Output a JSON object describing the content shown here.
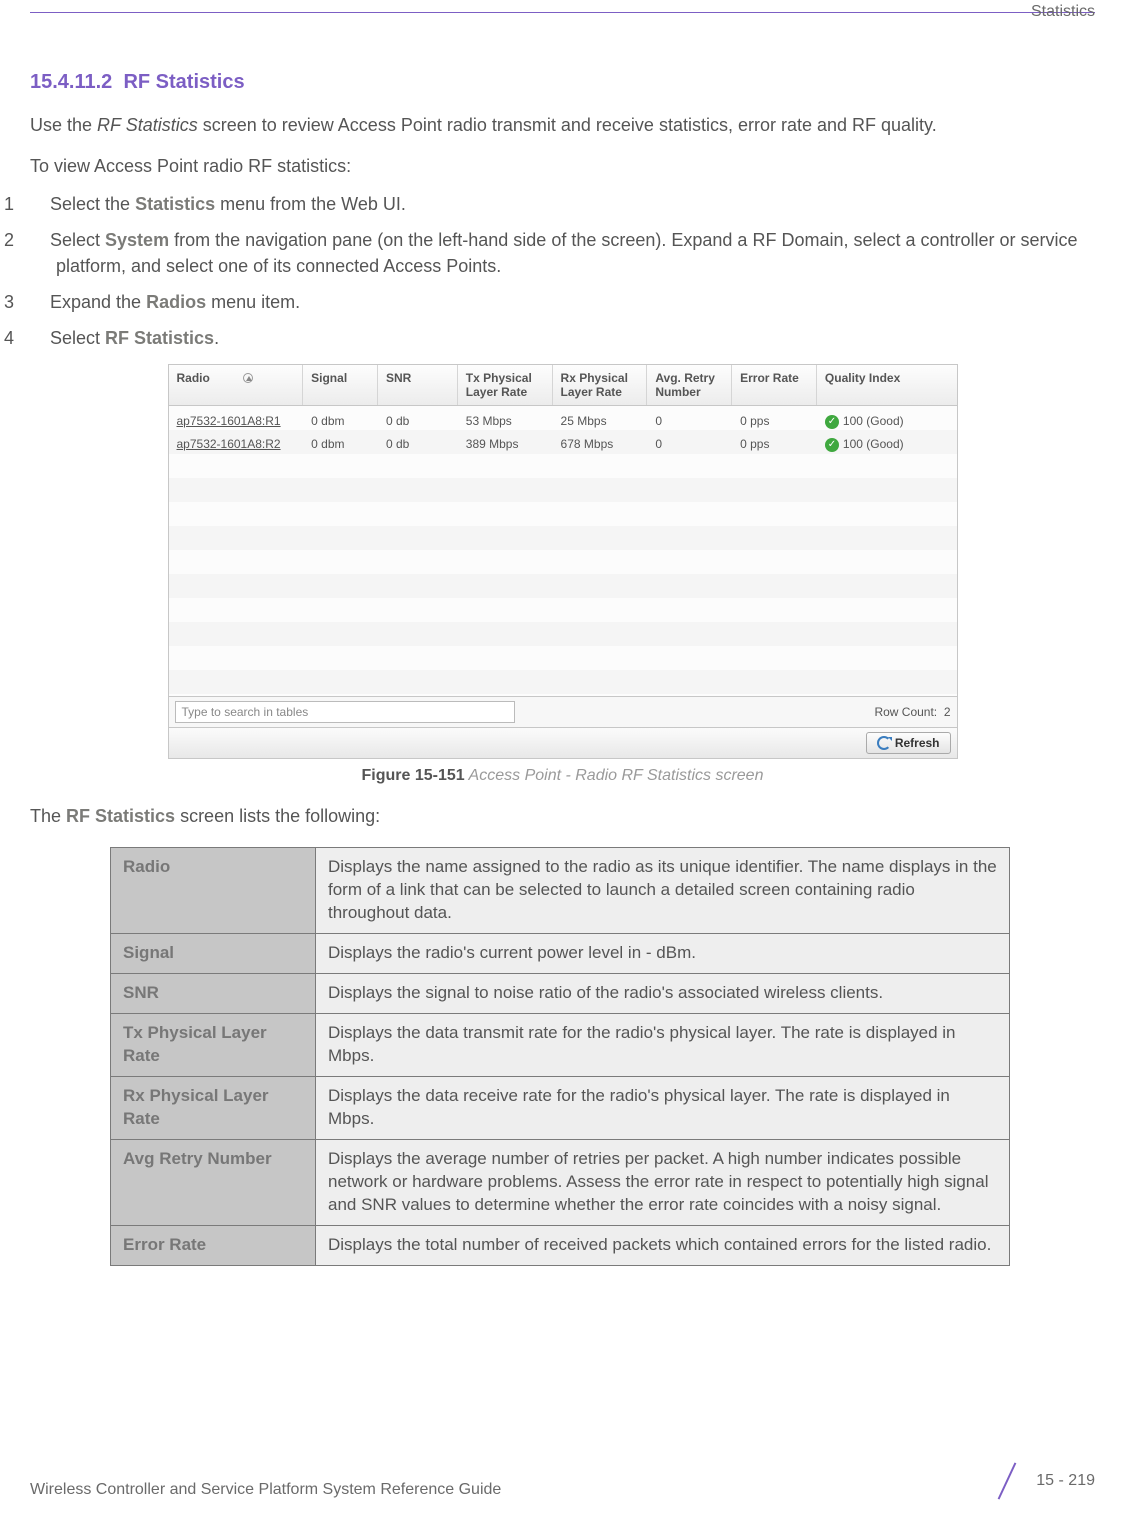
{
  "header": {
    "chapter": "Statistics"
  },
  "section": {
    "number": "15.4.11.2",
    "title": "RF Statistics"
  },
  "intro": {
    "before_em": "Use the ",
    "em": "RF Statistics",
    "after_em": " screen to review Access Point radio transmit and receive statistics, error rate and RF quality.",
    "subline": "To view Access Point radio RF statistics:"
  },
  "steps": [
    {
      "n": "1",
      "before1": "Select the ",
      "bold1": "Statistics",
      "after1": " menu from the Web UI."
    },
    {
      "n": "2",
      "before1": "Select ",
      "bold1": "System",
      "after1": " from the navigation pane (on the left-hand side of the screen). Expand a RF Domain, select a controller or service platform, and select one of its connected Access Points."
    },
    {
      "n": "3",
      "before1": "Expand the ",
      "bold1": "Radios",
      "after1": " menu item."
    },
    {
      "n": "4",
      "before1": "Select ",
      "bold1": "RF Statistics",
      "after1": "."
    }
  ],
  "screenshot": {
    "headers": [
      "Radio",
      "Signal",
      "SNR",
      "Tx Physical Layer Rate",
      "Rx Physical Layer Rate",
      "Avg. Retry Number",
      "Error Rate",
      "Quality Index"
    ],
    "rows": [
      {
        "radio": "ap7532-1601A8:R1",
        "signal": "0 dbm",
        "snr": "0 db",
        "tx": "53 Mbps",
        "rx": "25 Mbps",
        "retry": "0",
        "err": "0 pps",
        "quality": "100 (Good)"
      },
      {
        "radio": "ap7532-1601A8:R2",
        "signal": "0 dbm",
        "snr": "0 db",
        "tx": "389 Mbps",
        "rx": "678 Mbps",
        "retry": "0",
        "err": "0 pps",
        "quality": "100 (Good)"
      }
    ],
    "search_placeholder": "Type to search in tables",
    "row_count_label": "Row Count:",
    "row_count_value": "2",
    "refresh_label": "Refresh"
  },
  "figure": {
    "label": "Figure 15-151",
    "caption": "Access Point - Radio RF Statistics screen"
  },
  "list_intro": {
    "before": "The ",
    "bold": "RF Statistics",
    "after": " screen lists the following:"
  },
  "desc": [
    {
      "label": "Radio",
      "value": "Displays the name assigned to the radio as its unique identifier. The name displays in the form of a link that can be selected to launch a detailed screen containing radio throughout data."
    },
    {
      "label": "Signal",
      "value": "Displays the radio's current power level in - dBm."
    },
    {
      "label": "SNR",
      "value": "Displays the signal to noise ratio of the radio's associated wireless clients."
    },
    {
      "label": "Tx Physical Layer Rate",
      "value": "Displays the data transmit rate for the radio's physical layer. The rate is displayed in Mbps."
    },
    {
      "label": "Rx Physical Layer Rate",
      "value": "Displays the data receive rate for the radio's physical layer. The rate is displayed in Mbps."
    },
    {
      "label": "Avg Retry Number",
      "value": "Displays the average number of retries per packet. A high number indicates possible network or hardware problems. Assess the error rate in respect to potentially high signal and SNR values to determine whether the error rate coincides with a noisy signal."
    },
    {
      "label": "Error Rate",
      "value": "Displays the total number of received packets which contained errors for the listed radio."
    }
  ],
  "footer": {
    "guide": "Wireless Controller and Service Platform System Reference Guide",
    "page": "15 - 219"
  }
}
